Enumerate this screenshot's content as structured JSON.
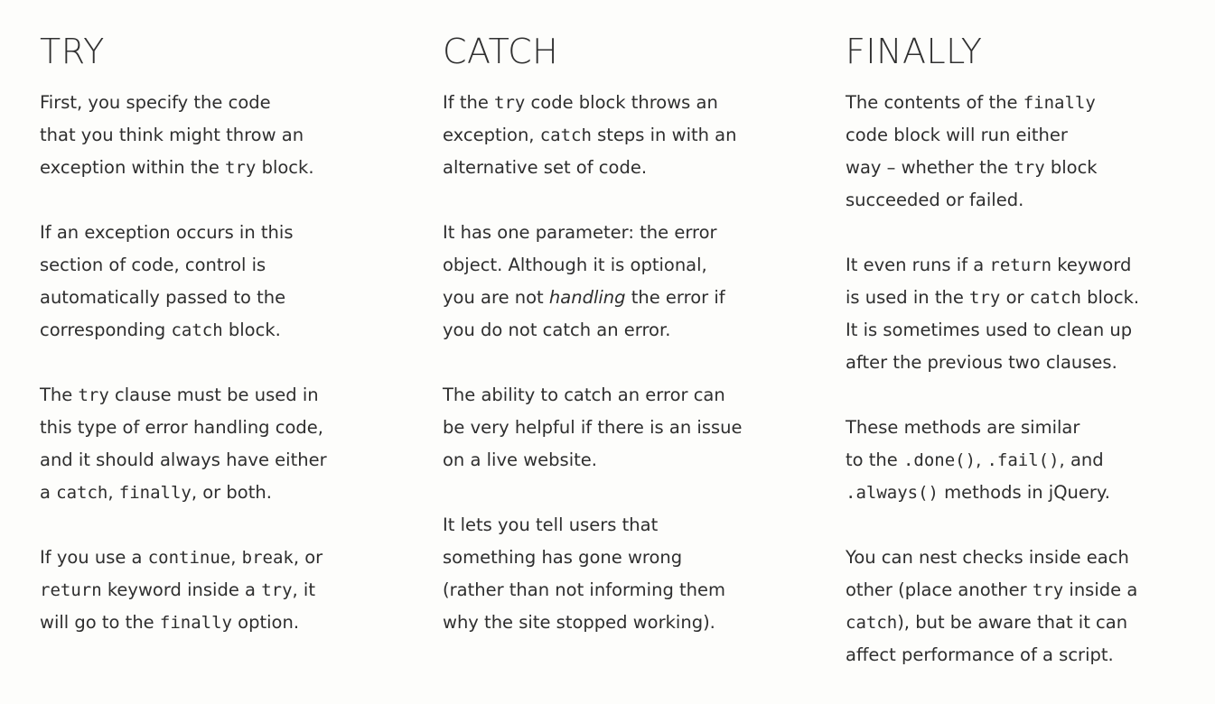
{
  "columns": [
    {
      "title": "TRY",
      "paragraphs": [
        [
          {
            "t": "First, you specify the code\nthat you think might throw an\nexception within the "
          },
          {
            "t": "try",
            "code": true
          },
          {
            "t": " block."
          }
        ],
        [
          {
            "t": "If an exception occurs in this\nsection of code, control is\nautomatically passed to the\ncorresponding "
          },
          {
            "t": "catch",
            "code": true
          },
          {
            "t": " block."
          }
        ],
        [
          {
            "t": "The "
          },
          {
            "t": "try",
            "code": true
          },
          {
            "t": " clause must be used in\nthis type of error handling code,\nand it should always have either\na "
          },
          {
            "t": "catch",
            "code": true
          },
          {
            "t": ", "
          },
          {
            "t": "finally",
            "code": true
          },
          {
            "t": ", or both."
          }
        ],
        [
          {
            "t": "If you use a "
          },
          {
            "t": "continue",
            "code": true
          },
          {
            "t": ", "
          },
          {
            "t": "break",
            "code": true
          },
          {
            "t": ", or\n"
          },
          {
            "t": "return",
            "code": true
          },
          {
            "t": " keyword inside a "
          },
          {
            "t": "try",
            "code": true
          },
          {
            "t": ", it\nwill go to the "
          },
          {
            "t": "finally",
            "code": true
          },
          {
            "t": " option."
          }
        ]
      ]
    },
    {
      "title": "CATCH",
      "paragraphs": [
        [
          {
            "t": "If the "
          },
          {
            "t": "try",
            "code": true
          },
          {
            "t": " code block throws an\nexception, "
          },
          {
            "t": "catch",
            "code": true
          },
          {
            "t": " steps in with an\nalternative set of code."
          }
        ],
        [
          {
            "t": "It has one parameter: the error\nobject. Although it is optional,\nyou are not "
          },
          {
            "t": "handling",
            "em": true
          },
          {
            "t": " the error if\nyou do not catch an error."
          }
        ],
        [
          {
            "t": "The ability to catch an error can\nbe very helpful if there is an issue\non a live website."
          }
        ],
        [
          {
            "t": "It lets you tell users that\nsomething has gone wrong\n(rather than not informing them\nwhy the site stopped working)."
          }
        ]
      ]
    },
    {
      "title": "FINALLY",
      "paragraphs": [
        [
          {
            "t": "The contents of the "
          },
          {
            "t": "finally",
            "code": true
          },
          {
            "t": "\ncode block will run either\nway – whether the "
          },
          {
            "t": "try",
            "code": true
          },
          {
            "t": " block\nsucceeded or failed."
          }
        ],
        [
          {
            "t": "It even runs if a "
          },
          {
            "t": "return",
            "code": true
          },
          {
            "t": " keyword\nis used in the "
          },
          {
            "t": "try",
            "code": true
          },
          {
            "t": " or "
          },
          {
            "t": "catch",
            "code": true
          },
          {
            "t": " block.\nIt is sometimes used to clean up\nafter the previous two clauses."
          }
        ],
        [
          {
            "t": "These methods are similar\nto the "
          },
          {
            "t": ".done()",
            "code": true
          },
          {
            "t": ", "
          },
          {
            "t": ".fail()",
            "code": true
          },
          {
            "t": ", and\n"
          },
          {
            "t": ".always()",
            "code": true
          },
          {
            "t": " methods in jQuery."
          }
        ],
        [
          {
            "t": "You can nest checks inside each\nother (place another "
          },
          {
            "t": "try",
            "code": true
          },
          {
            "t": " inside a\n"
          },
          {
            "t": "catch",
            "code": true
          },
          {
            "t": "), but be aware that it can\naffect performance of a script."
          }
        ]
      ]
    }
  ]
}
